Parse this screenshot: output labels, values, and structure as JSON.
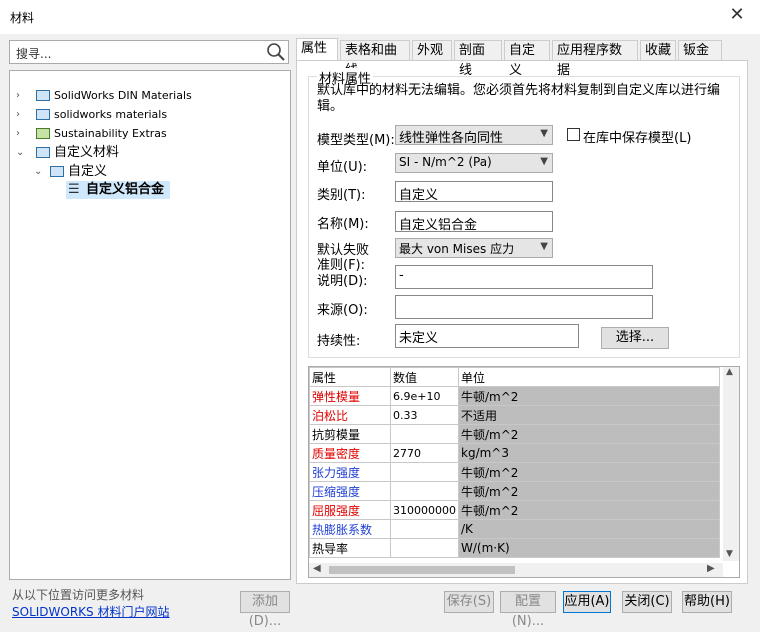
{
  "window": {
    "title": "材料",
    "close_glyph": "✕"
  },
  "search": {
    "placeholder": "搜寻..."
  },
  "tree": {
    "items": [
      {
        "label": "SolidWorks DIN Materials",
        "arrow": "›"
      },
      {
        "label": "solidworks materials",
        "arrow": "›"
      },
      {
        "label": "Sustainability Extras",
        "arrow": "›"
      },
      {
        "label": "自定义材料",
        "arrow": "⌄"
      },
      {
        "label": "自定义",
        "arrow": "⌄"
      },
      {
        "label": "自定义铝合金",
        "icon_glyph": "☰"
      }
    ]
  },
  "tabs": [
    "属性",
    "表格和曲线",
    "外观",
    "剖面线",
    "自定义",
    "应用程序数据",
    "收藏",
    "钣金"
  ],
  "properties": {
    "group_title": "材料属性",
    "notice": "默认库中的材料无法编辑。您必须首先将材料复制到自定义库以进行编辑。",
    "model_type_label": "模型类型(M):",
    "model_type_value": "线性弹性各向同性",
    "save_in_lib_label": "在库中保存模型(L)",
    "unit_label": "单位(U):",
    "unit_value": "SI - N/m^2 (Pa)",
    "category_label": "类别(T):",
    "category_value": "自定义",
    "name_label": "名称(M):",
    "name_value": "自定义铝合金",
    "failure_label_1": "默认失败",
    "failure_label_2": "准则(F):",
    "failure_value": "最大 von Mises 应力",
    "desc_label": "说明(D):",
    "desc_value": "-",
    "source_label": "来源(O):",
    "source_value": "",
    "sustain_label": "持续性:",
    "sustain_value": "未定义",
    "select_button": "选择..."
  },
  "grid": {
    "headers": [
      "属性",
      "数值",
      "单位"
    ],
    "rows": [
      {
        "name": "弹性模量",
        "value": "6.9e+10",
        "unit": "牛顿/m^2",
        "color": "#e00000"
      },
      {
        "name": "泊松比",
        "value": "0.33",
        "unit": "不适用",
        "color": "#e00000"
      },
      {
        "name": "抗剪模量",
        "value": "",
        "unit": "牛顿/m^2",
        "color": "#000000"
      },
      {
        "name": "质量密度",
        "value": "2770",
        "unit": "kg/m^3",
        "color": "#e00000"
      },
      {
        "name": "张力强度",
        "value": "",
        "unit": "牛顿/m^2",
        "color": "#1f3fd6"
      },
      {
        "name": "压缩强度",
        "value": "",
        "unit": "牛顿/m^2",
        "color": "#1f3fd6"
      },
      {
        "name": "屈服强度",
        "value": "310000000",
        "unit": "牛顿/m^2",
        "color": "#e00000"
      },
      {
        "name": "热膨胀系数",
        "value": "",
        "unit": "/K",
        "color": "#1f3fd6"
      },
      {
        "name": "热导率",
        "value": "",
        "unit": "W/(m·K)",
        "color": "#000000"
      }
    ]
  },
  "footer": {
    "info": "从以下位置访问更多材料",
    "link": "SOLIDWORKS 材料门户网站",
    "add": "添加(D)...",
    "save": "保存(S)",
    "config": "配置(N)...",
    "apply": "应用(A)",
    "close": "关闭(C)",
    "help": "帮助(H)"
  }
}
